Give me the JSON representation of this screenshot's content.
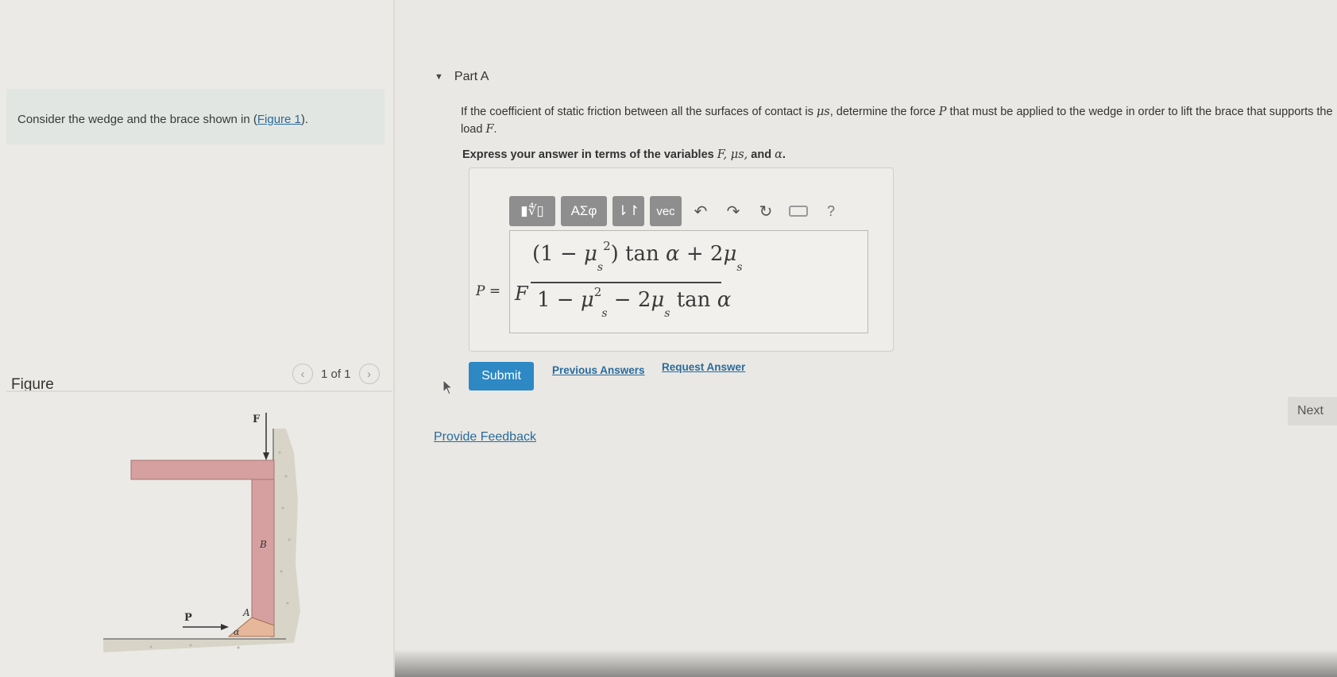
{
  "intro": {
    "text": "Consider the wedge and the brace shown in (",
    "link": "Figure 1",
    "text_end": ")."
  },
  "figure": {
    "title": "Figure",
    "counter": "1 of 1",
    "labels": {
      "F": "F",
      "B": "B",
      "P": "P",
      "A": "A",
      "alpha": "α"
    }
  },
  "part": {
    "title": "Part A"
  },
  "question": {
    "before_mu": "If the coefficient of static friction between all the surfaces of contact is ",
    "mu": "μs",
    "after_mu": ", determine the force ",
    "P": "P",
    "after_P": " that must be applied to the wedge in order to lift the brace that supports the load ",
    "F": "F",
    "end": "."
  },
  "instruction": {
    "before": "Express your answer in terms of the variables ",
    "vars": "F, μs,",
    "and": " and ",
    "alpha": "α",
    "end": "."
  },
  "toolbar": {
    "templates": "▮∜▯",
    "greek": "ΑΣφ",
    "sort": "⇂↾",
    "vec": "vec",
    "undo": "↶",
    "redo": "↷",
    "reset": "↻",
    "help": "?"
  },
  "answer": {
    "lhs": "P =",
    "F": "F",
    "numerator": {
      "open": "(1 − ",
      "mu": "μ",
      "sub": "s",
      "sup": "2",
      "close": ")",
      "rest": " tan ",
      "alpha": "α",
      "plus": " + 2",
      "mu2": "μ",
      "sub2": "s"
    },
    "denominator": {
      "one": "1 − ",
      "mu": "μ",
      "sup": "2",
      "sub": "s",
      "minus": " − 2",
      "mu2": "μ",
      "sub2": "s",
      "tan": " tan ",
      "alpha": "α"
    }
  },
  "actions": {
    "submit": "Submit",
    "previous": "Previous Answers",
    "request": "Request Answer",
    "feedback": "Provide Feedback",
    "next": "Next"
  }
}
